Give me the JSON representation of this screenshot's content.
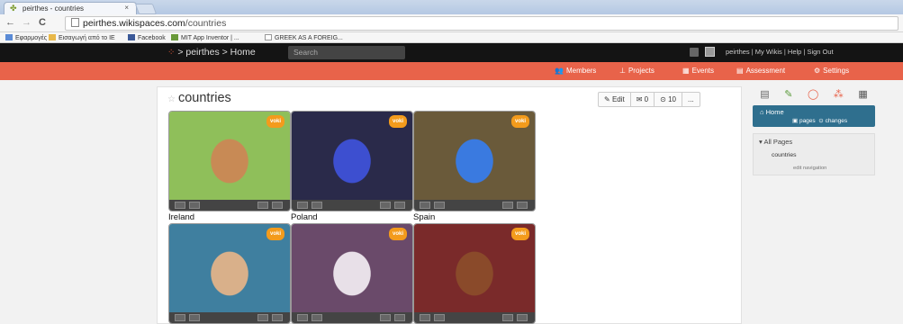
{
  "browser": {
    "tab_title": "peirthes - countries",
    "tab_close": "×",
    "url_host": "peirthes.wikispaces.com",
    "url_path": "/countries",
    "back": "←",
    "forward": "→",
    "reload": "C",
    "bookmarks": [
      {
        "label": "Εφαρμογές",
        "color": "#5b8bd6"
      },
      {
        "label": "Εισαγωγή από το IE",
        "color": "#e8b84a"
      },
      {
        "label": "Facebook",
        "color": "#3b5998"
      },
      {
        "label": "MIT App Inventor | ...",
        "color": "#6a9a3a"
      },
      {
        "label": "GREEK AS A FOREIG...",
        "color": "#ffffff"
      }
    ]
  },
  "wiki": {
    "breadcrumb": "> peirthes > Home",
    "search_placeholder": "Search",
    "top_links": "peirthes | My Wikis | Help | Sign Out",
    "nav": [
      {
        "label": "Members",
        "icon": "👥"
      },
      {
        "label": "Projects",
        "icon": "⊥"
      },
      {
        "label": "Events",
        "icon": "▦"
      },
      {
        "label": "Assessment",
        "icon": "▤"
      },
      {
        "label": "Settings",
        "icon": "⚙"
      }
    ],
    "accent": "#e8634a"
  },
  "page": {
    "title": "countries",
    "star": "☆",
    "edit_label": "Edit",
    "comments_count": "0",
    "views_count": "10",
    "more": "..."
  },
  "cards": [
    {
      "caption": "Ireland",
      "bg": "#8fbf5a",
      "face": "#c88a55"
    },
    {
      "caption": "Poland",
      "bg": "#2a2a4a",
      "face": "#3d4fd0"
    },
    {
      "caption": "Spain",
      "bg": "#6a5a3a",
      "face": "#3a7ae0"
    },
    {
      "caption": "",
      "bg": "#3f7f9f",
      "face": "#d9b08a"
    },
    {
      "caption": "",
      "bg": "#6a4a6a",
      "face": "#e8e0e8"
    },
    {
      "caption": "",
      "bg": "#7a2a2a",
      "face": "#8a4a2a"
    }
  ],
  "voki_label": "voki",
  "sidebar": {
    "home_label": "Home",
    "pages_label": "pages",
    "changes_label": "changes",
    "all_pages": "All Pages",
    "page_item": "countries",
    "edit_nav": "edit navigation"
  }
}
